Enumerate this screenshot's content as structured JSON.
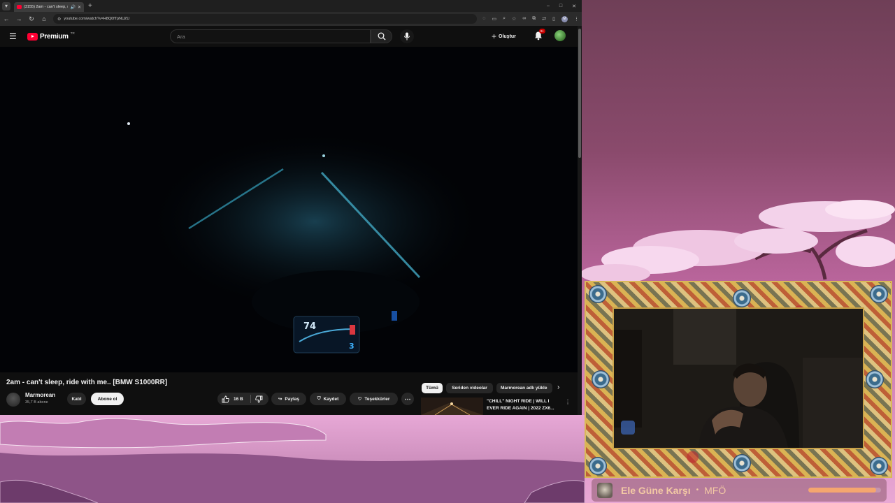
{
  "browser": {
    "tab_title": "(3155) 2am - can't sleep, ri…",
    "url": "youtube.com/watch?v=H8Q0fTpNUZU",
    "new_tab_symbol": "+",
    "minimize_symbol": "–",
    "maximize_symbol": "□",
    "close_symbol": "✕"
  },
  "youtube": {
    "logo_text": "Premium",
    "region": "TR",
    "search_placeholder": "Ara",
    "create_label": "Oluştur",
    "notification_badge": "9+"
  },
  "video": {
    "title": "2am - can't sleep, ride with me.. [BMW S1000RR]",
    "speed_readout": "74",
    "gear_readout": "3",
    "channel": {
      "name": "Marmorean",
      "subscribers": "35,7 B abone"
    },
    "join_label": "Katıl",
    "subscribe_label": "Abone ol",
    "like_count": "16 B",
    "share_label": "Paylaş",
    "save_label": "Kaydet",
    "thanks_label": "Teşekkürler"
  },
  "recommendations": {
    "chips": [
      "Tümü",
      "Seriden videolar",
      "Marmorean adlı yükle"
    ],
    "first_video_title": "\"CHILL\" NIGHT RIDE | WILL I EVER RIDE AGAIN | 2022 ZX6..."
  },
  "now_playing": {
    "title": "Ele Güne Karşı",
    "separator": "•",
    "artist": "MFÖ",
    "progress": 0.93
  },
  "colors": {
    "youtube_red": "#ff0033",
    "page_bg": "#0f0f0f",
    "np_text": "#f3c9a4",
    "np_progress": "#f5a66e"
  }
}
